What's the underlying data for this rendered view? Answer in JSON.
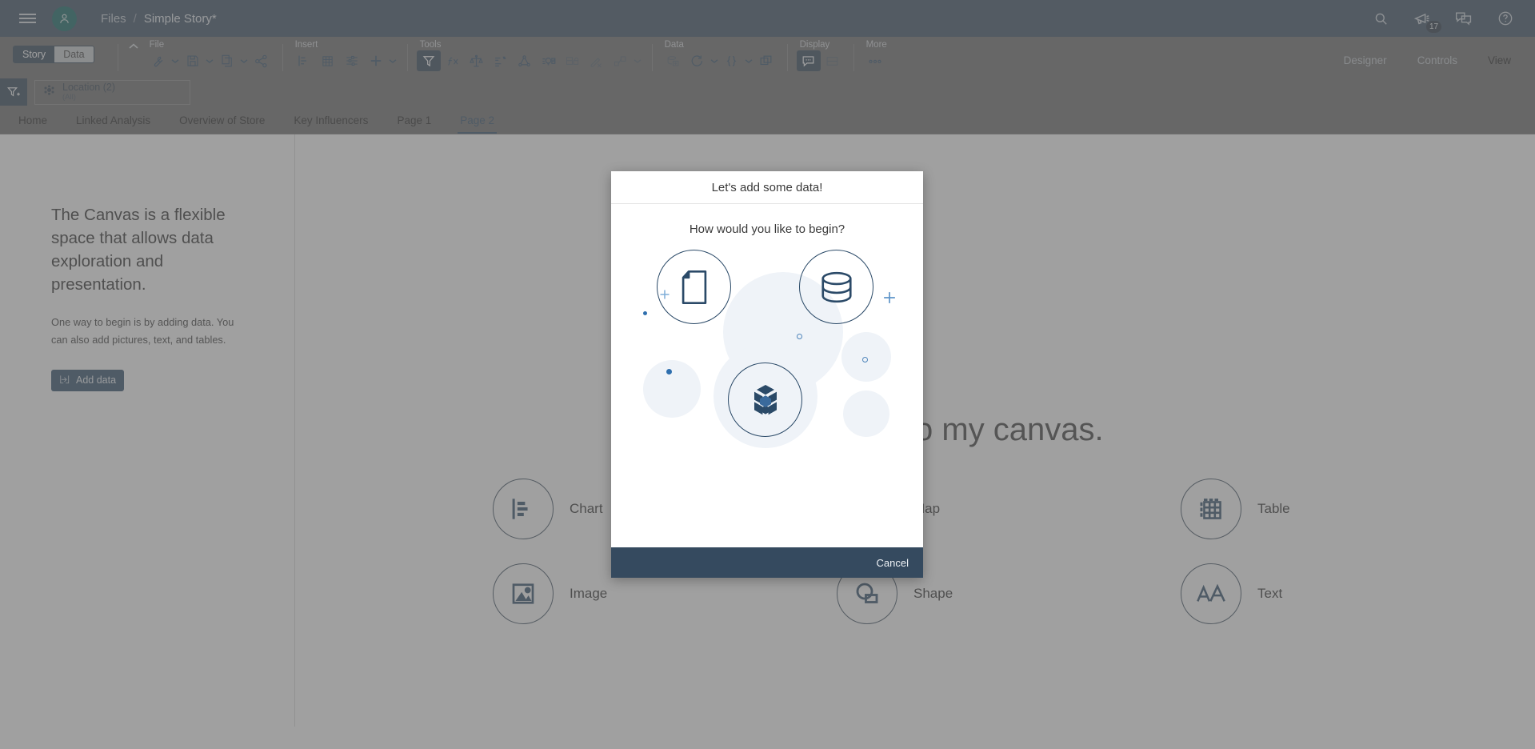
{
  "topbar": {
    "menu_icon": "hamburger-icon",
    "avatar_icon": "user-avatar-icon",
    "breadcrumb": {
      "root": "Files",
      "separator": "/",
      "current": "Simple Story*"
    },
    "actions": [
      {
        "name": "search-icon",
        "label": "Search"
      },
      {
        "name": "announcements-icon",
        "label": "Announcements",
        "badge": "17"
      },
      {
        "name": "comments-icon",
        "label": "Comments"
      },
      {
        "name": "help-icon",
        "label": "Help"
      }
    ]
  },
  "ribbon": {
    "mode_toggle": {
      "story": "Story",
      "data": "Data",
      "active": "Story"
    },
    "collapse_icon": "chevron-up-icon",
    "groups": [
      {
        "label": "File",
        "items": [
          {
            "name": "tools-wrench-icon",
            "caret": true,
            "state": "normal"
          },
          {
            "name": "save-icon",
            "caret": true,
            "state": "normal"
          },
          {
            "name": "copy-icon",
            "caret": true,
            "state": "normal"
          },
          {
            "name": "share-icon",
            "caret": false,
            "state": "normal"
          }
        ]
      },
      {
        "label": "Insert",
        "items": [
          {
            "name": "chart-icon",
            "caret": false,
            "state": "normal"
          },
          {
            "name": "table-icon",
            "caret": false,
            "state": "normal"
          },
          {
            "name": "controls-icon",
            "caret": false,
            "state": "normal"
          },
          {
            "name": "add-plus-icon",
            "caret": true,
            "state": "normal"
          }
        ]
      },
      {
        "label": "Tools",
        "items": [
          {
            "name": "filter-icon",
            "caret": false,
            "state": "active"
          },
          {
            "name": "formula-fx-icon",
            "caret": false,
            "state": "normal"
          },
          {
            "name": "scales-compare-icon",
            "caret": false,
            "state": "normal"
          },
          {
            "name": "sort-rank-icon",
            "caret": false,
            "state": "normal"
          },
          {
            "name": "network-graph-icon",
            "caret": false,
            "state": "normal"
          },
          {
            "name": "insight-bulb-icon",
            "caret": false,
            "state": "normal"
          },
          {
            "name": "layout-lock-icon",
            "caret": false,
            "state": "disabled"
          },
          {
            "name": "edit-remove-icon",
            "caret": false,
            "state": "disabled"
          },
          {
            "name": "shapes-icon",
            "caret": true,
            "state": "disabled"
          }
        ]
      },
      {
        "label": "Data",
        "items": [
          {
            "name": "database-add-icon",
            "caret": false,
            "state": "disabled"
          },
          {
            "name": "refresh-icon",
            "caret": true,
            "state": "normal"
          },
          {
            "name": "braces-code-icon",
            "caret": true,
            "state": "normal"
          },
          {
            "name": "layers-icon",
            "caret": false,
            "state": "normal"
          }
        ]
      },
      {
        "label": "Display",
        "items": [
          {
            "name": "comment-bubble-icon",
            "caret": false,
            "state": "active"
          },
          {
            "name": "panel-split-icon",
            "caret": false,
            "state": "disabled"
          }
        ]
      },
      {
        "label": "More",
        "items": [
          {
            "name": "overflow-dots-icon",
            "caret": false,
            "state": "normal"
          }
        ]
      }
    ],
    "right_items": [
      {
        "label": "Designer",
        "selected": false
      },
      {
        "label": "Controls",
        "selected": false
      },
      {
        "label": "View",
        "selected": true
      }
    ]
  },
  "filterbar": {
    "add_filter_icon": "add-filter-icon",
    "chips": [
      {
        "icon": "dimension-icon",
        "name": "Location (2)",
        "value": "(All)"
      }
    ]
  },
  "page_tabs": {
    "items": [
      {
        "label": "Home",
        "active": false
      },
      {
        "label": "Linked Analysis",
        "active": false
      },
      {
        "label": "Overview of Store",
        "active": false
      },
      {
        "label": "Key Influencers",
        "active": false
      },
      {
        "label": "Page 1",
        "active": false
      },
      {
        "label": "Page 2",
        "active": true
      }
    ]
  },
  "left_panel": {
    "title": "The Canvas is a flexible space that allows data exploration and presentation.",
    "subtitle": "One way to begin is by adding data. You can also add pictures, text, and tables.",
    "add_data_button": {
      "label": "Add data",
      "icon": "import-data-icon"
    }
  },
  "canvas": {
    "heading": "Add an item to my canvas.",
    "options": [
      {
        "label": "Chart",
        "icon": "bar-chart-icon"
      },
      {
        "label": "Map",
        "icon": "map-pin-icon"
      },
      {
        "label": "Table",
        "icon": "table-grid-icon"
      },
      {
        "label": "Image",
        "icon": "image-picture-icon"
      },
      {
        "label": "Shape",
        "icon": "shape-circle-icon"
      },
      {
        "label": "Text",
        "icon": "text-aa-icon"
      }
    ]
  },
  "modal": {
    "title": "Let's add some data!",
    "question": "How would you like to begin?",
    "options": [
      {
        "name": "file-source-option",
        "icon": "file-document-icon",
        "label": ""
      },
      {
        "name": "database-source-option",
        "icon": "database-cylinder-icon",
        "label": ""
      },
      {
        "name": "model-source-option",
        "icon": "data-model-cube-icon",
        "label": ""
      }
    ],
    "cancel_label": "Cancel"
  },
  "colors": {
    "header_bg": "#354a5f",
    "ribbon_bg": "#6b6b6b",
    "accent_blue": "#2b4a68",
    "avatar_green": "#0a6160",
    "icon_blue": "#2b4a68",
    "modal_footer": "#354a5f"
  }
}
